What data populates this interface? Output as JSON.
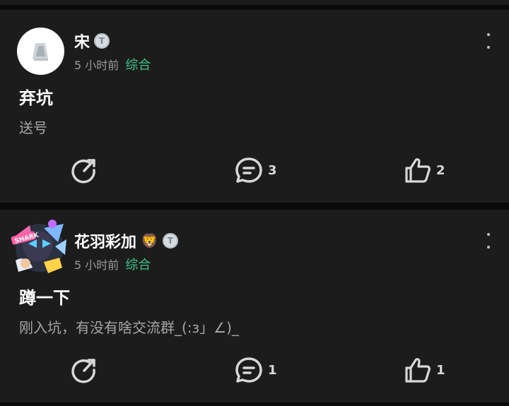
{
  "posts": [
    {
      "username": "宋",
      "level_badge": "T",
      "time": "5 小时前",
      "category": "综合",
      "title": "弃坑",
      "body": "送号",
      "comments": "3",
      "likes": "2",
      "avatar": "white-placeholder-avatar"
    },
    {
      "username": "花羽彩加",
      "level_badge": "T",
      "emoji": "🦁",
      "time": "5 小时前",
      "category": "综合",
      "title": "蹲一下",
      "body": "刚入坑，有没有啥交流群_(:з」∠)_",
      "comments": "1",
      "likes": "1",
      "avatar": "anime-sticker-avatar"
    }
  ],
  "colors": {
    "card_bg": "#1c1c1c",
    "page_bg": "#0a0a0a",
    "category": "#3fc28a",
    "meta": "#9a9a9a"
  },
  "icons": {
    "share": "share-icon",
    "comment": "comment-icon",
    "like": "thumbs-up-icon",
    "more": "more-vertical-icon"
  }
}
